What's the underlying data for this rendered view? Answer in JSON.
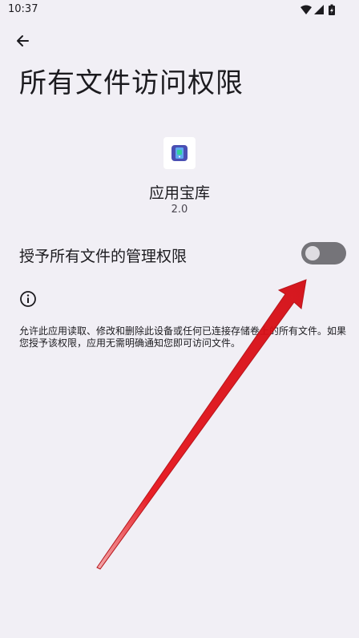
{
  "status_bar": {
    "time": "10:37",
    "icons": [
      "wifi-icon",
      "cell-signal-icon",
      "battery-charging-icon"
    ]
  },
  "header": {
    "back_icon": "arrow-back-icon",
    "title": "所有文件访问权限"
  },
  "app": {
    "icon": "app-store-icon",
    "name": "应用宝库",
    "version": "2.0"
  },
  "setting": {
    "label": "授予所有文件的管理权限",
    "toggle_on": false
  },
  "info": {
    "icon": "info-icon",
    "description": "允许此应用读取、修改和删除此设备或任何已连接存储卷上的所有文件。如果您授予该权限，应用无需明确通知您即可访问文件。"
  },
  "colors": {
    "background": "#f1eff5",
    "annotation_arrow": "#e8141b",
    "app_icon_bg": "#4a4fb3",
    "app_icon_accent": "#2fd29a"
  }
}
